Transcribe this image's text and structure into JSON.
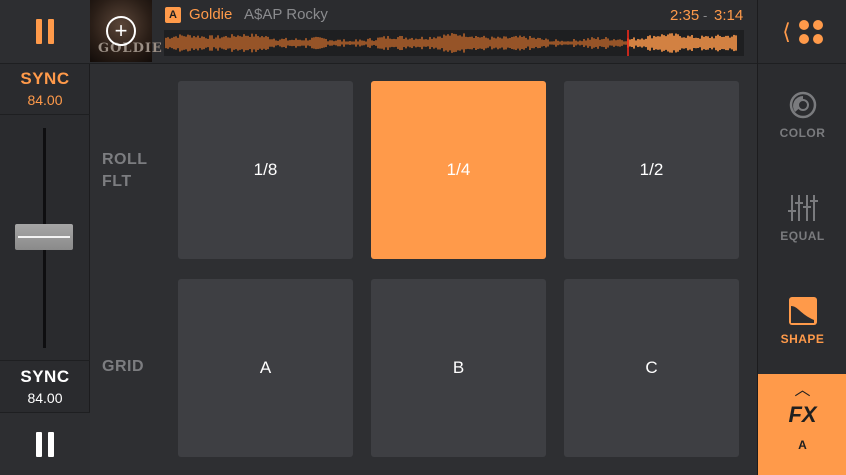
{
  "deck_left": {
    "sync_top": {
      "label": "SYNC",
      "value": "84.00"
    },
    "sync_bottom": {
      "label": "SYNC",
      "value": "84.00"
    }
  },
  "header": {
    "album_art_text": "GOLDIE",
    "deck": "A",
    "title": "Goldie",
    "artist": "A$AP Rocky",
    "elapsed": "2:35",
    "separator": "-",
    "total": "3:14",
    "playback_progress": 0.8
  },
  "fx": {
    "rows": [
      {
        "label_line1": "ROLL",
        "label_line2": "FLT",
        "pads": [
          "1/8",
          "1/4",
          "1/2"
        ],
        "active_index": 1
      },
      {
        "label_line1": "GRID",
        "label_line2": "",
        "pads": [
          "A",
          "B",
          "C"
        ],
        "active_index": -1
      }
    ]
  },
  "sidebar": {
    "color_label": "COLOR",
    "equal_label": "EQUAL",
    "shape_label": "SHAPE",
    "fx_label": "FX",
    "fx_deck": "A",
    "fx_caret": "︿"
  },
  "colors": {
    "accent": "#ff9a4a",
    "pad": "#3e3f43",
    "background": "#2a2b2e",
    "inactive_text": "#7c7d80"
  },
  "icons": {
    "top_pause": "pause-icon",
    "bottom_pause": "pause-icon",
    "album_add": "plus-circle-icon",
    "nav": "chevron-left-icon",
    "grid": "grid-dots-icon",
    "color": "color-knob-icon",
    "equal": "equalizer-sliders-icon",
    "shape": "shape-curve-icon"
  }
}
